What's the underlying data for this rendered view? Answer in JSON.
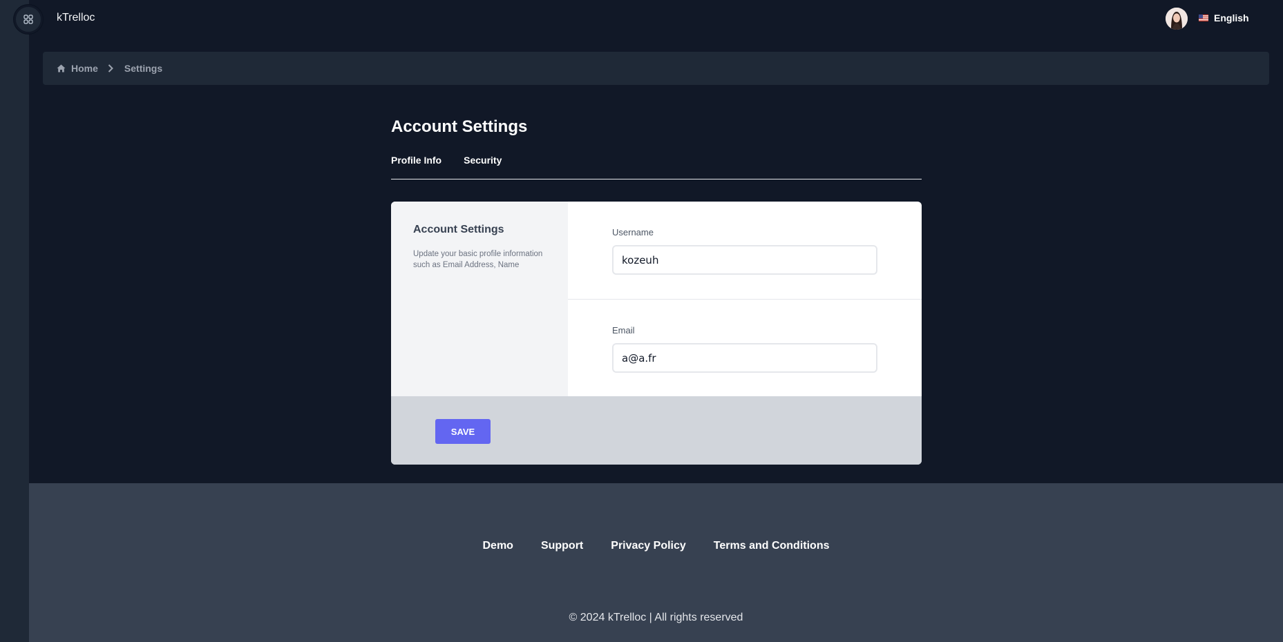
{
  "app": {
    "title": "kTrelloc"
  },
  "header": {
    "language": "English",
    "avatar_icon": "user-avatar"
  },
  "breadcrumb": {
    "home": "Home",
    "current": "Settings"
  },
  "page": {
    "title": "Account Settings",
    "tabs": [
      {
        "label": "Profile Info",
        "active": true
      },
      {
        "label": "Security",
        "active": false
      }
    ]
  },
  "card": {
    "heading": "Account Settings",
    "description": "Update your basic profile information such as Email Address, Name",
    "fields": {
      "username": {
        "label": "Username",
        "value": "kozeuh"
      },
      "email": {
        "label": "Email",
        "value": "a@a.fr"
      }
    },
    "save_label": "SAVE"
  },
  "footer": {
    "links": [
      "Demo",
      "Support",
      "Privacy Policy",
      "Terms and Conditions"
    ],
    "copyright": "© 2024 kTrelloc | All rights reserved"
  },
  "colors": {
    "background": "#111827",
    "panel": "#1f2937",
    "accent": "#6366f1",
    "footer": "#374151"
  }
}
